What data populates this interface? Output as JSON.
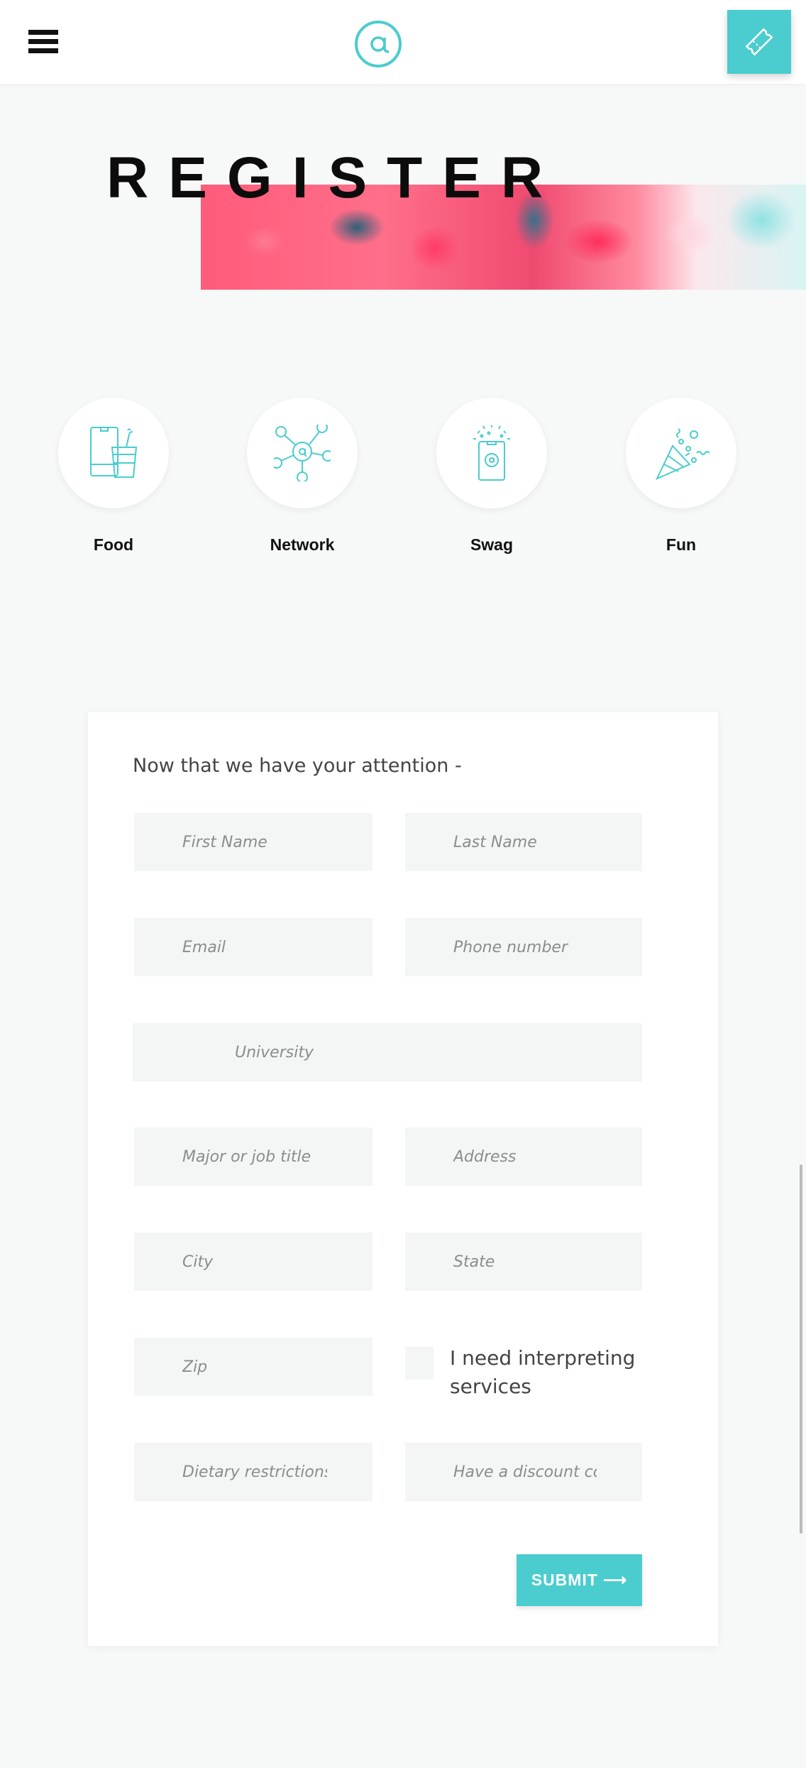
{
  "header": {
    "menu_icon": "hamburger-menu-icon",
    "logo_icon": "at-sign-logo-icon",
    "ticket_icon": "ticket-icon",
    "accent_color": "#4bccce"
  },
  "hero": {
    "title": "REGISTER"
  },
  "perks": [
    {
      "label": "Food",
      "icon": "food-drink-icon"
    },
    {
      "label": "Network",
      "icon": "network-icon"
    },
    {
      "label": "Swag",
      "icon": "swag-phone-icon"
    },
    {
      "label": "Fun",
      "icon": "party-popper-icon"
    }
  ],
  "form": {
    "intro": "Now that we have your attention -",
    "fields": {
      "first_name": "First Name",
      "last_name": "Last Name",
      "email": "Email",
      "phone": "Phone number",
      "university": "University",
      "major": "Major or job title",
      "address": "Address",
      "city": "City",
      "state": "State",
      "zip": "Zip",
      "dietary": "Dietary restrictions",
      "discount": "Have a discount code?"
    },
    "interpreting_label": "I need interpreting services",
    "submit_label": "SUBMIT ⟶"
  }
}
